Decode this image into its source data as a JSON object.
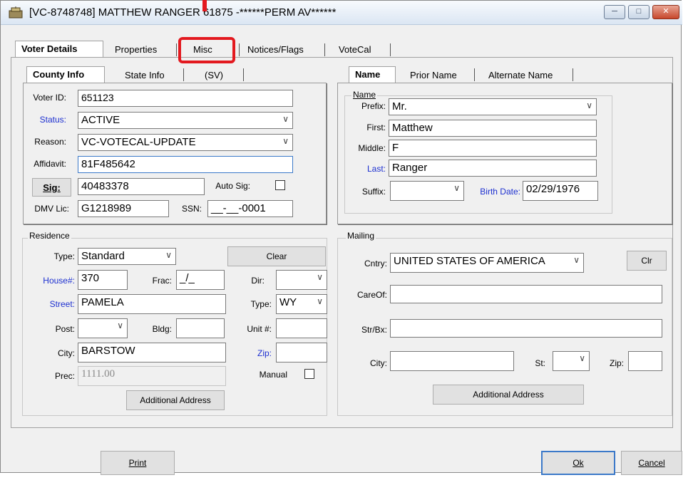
{
  "window": {
    "title": "[VC-8748748] MATTHEW RANGER 61875 -******PERM AV******",
    "minimize": "─",
    "maximize": "□",
    "close": "✕"
  },
  "tabs": [
    "Voter Details",
    "Properties",
    "Misc",
    "Notices/Flags",
    "VoteCal"
  ],
  "subtabs_left": [
    "County Info",
    "State Info",
    "(SV)"
  ],
  "subtabs_right": [
    "Name",
    "Prior Name",
    "Alternate Name"
  ],
  "county": {
    "voter_id_label": "Voter ID:",
    "voter_id": "651123",
    "status_label": "Status:",
    "status": "ACTIVE",
    "reason_label": "Reason:",
    "reason": "VC-VOTECAL-UPDATE",
    "affidavit_label": "Affidavit:",
    "affidavit": "81F485642",
    "sig_button": "Sig:",
    "sig": "40483378",
    "auto_sig_label": "Auto Sig:",
    "dmv_label": "DMV Lic:",
    "dmv": "G1218989",
    "ssn_label": "SSN:",
    "ssn": "__-__-0001"
  },
  "name": {
    "group": "Name",
    "prefix_label": "Prefix:",
    "prefix": "Mr.",
    "first_label": "First:",
    "first": "Matthew",
    "middle_label": "Middle:",
    "middle": "F",
    "last_label": "Last:",
    "last": "Ranger",
    "suffix_label": "Suffix:",
    "suffix": "",
    "birth_label": "Birth Date:",
    "birth": "02/29/1976"
  },
  "residence": {
    "group": "Residence",
    "type_label": "Type:",
    "type": "Standard",
    "clear_button": "Clear",
    "house_label": "House#:",
    "house": "370",
    "frac_label": "Frac:",
    "frac": "_/_",
    "dir_label": "Dir:",
    "dir": "",
    "street_label": "Street:",
    "street": "PAMELA",
    "street_type_label": "Type:",
    "street_type": "WY",
    "post_label": "Post:",
    "post": "",
    "bldg_label": "Bldg:",
    "bldg": "",
    "unit_label": "Unit #:",
    "unit": "",
    "city_label": "City:",
    "city": "BARSTOW",
    "zip_label": "Zip:",
    "zip": "",
    "prec_label": "Prec:",
    "prec": "1111.00",
    "manual_label": "Manual",
    "additional_button": "Additional Address"
  },
  "mailing": {
    "group": "Mailing",
    "country_label": "Cntry:",
    "country": "UNITED STATES OF AMERICA",
    "clr_button": "Clr",
    "careof_label": "CareOf:",
    "careof": "",
    "strbx_label": "Str/Bx:",
    "strbx": "",
    "city_label": "City:",
    "city": "",
    "st_label": "St:",
    "st": "",
    "zip_label": "Zip:",
    "zip": "",
    "additional_button": "Additional Address"
  },
  "footer": {
    "print": "Print",
    "ok": "Ok",
    "cancel": "Cancel"
  },
  "colors": {
    "highlight": "#e3191f",
    "link_label": "#1c2fd0",
    "focus": "#3b79c9"
  }
}
